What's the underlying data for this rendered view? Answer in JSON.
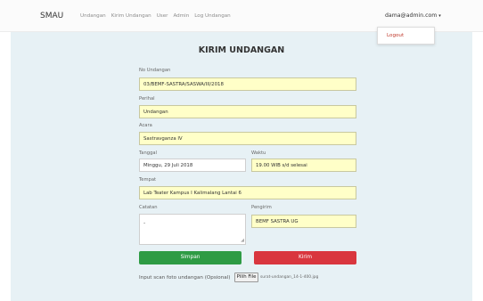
{
  "navbar": {
    "brand": "SMAU",
    "links": [
      "Undangan",
      "Kirim Undangan",
      "User",
      "Admin",
      "Log Undangan"
    ],
    "user_email": "dama@admin.com",
    "caret": "▾",
    "dropdown": {
      "logout_label": "Logout"
    }
  },
  "form": {
    "title": "KIRIM UNDANGAN",
    "no_undangan": {
      "label": "No Undangan",
      "value": "03/BEMF-SASTRA/SASWA/III/2018"
    },
    "perihal": {
      "label": "Perihal",
      "value": "Undangan"
    },
    "acara": {
      "label": "Acara",
      "value": "Sastravganza IV"
    },
    "tanggal": {
      "label": "Tanggal",
      "value": "Minggu, 29 Juli 2018"
    },
    "waktu": {
      "label": "Waktu",
      "value": "19.00 WIB s/d selesai"
    },
    "tempat": {
      "label": "Tempat",
      "value": "Lab Teater Kampus I Kalimalang Lantai 6"
    },
    "catatan": {
      "label": "Catatan",
      "value": "-"
    },
    "pengirim": {
      "label": "Pengirim",
      "value": "BEMF SASTRA UG"
    },
    "simpan_label": "Simpan",
    "kirim_label": "Kirim",
    "upload_label": "Input scan foto undangan (Opsional)",
    "file_button": "Pilih File",
    "file_name": "surat-undangan_14-1-400.jpg"
  },
  "colors": {
    "panel_bg": "#e7f1f5",
    "field_yellow": "#ffffc8",
    "simpan_green": "#2e9b44",
    "kirim_red": "#d9363e",
    "logout_red": "#c0392b"
  }
}
